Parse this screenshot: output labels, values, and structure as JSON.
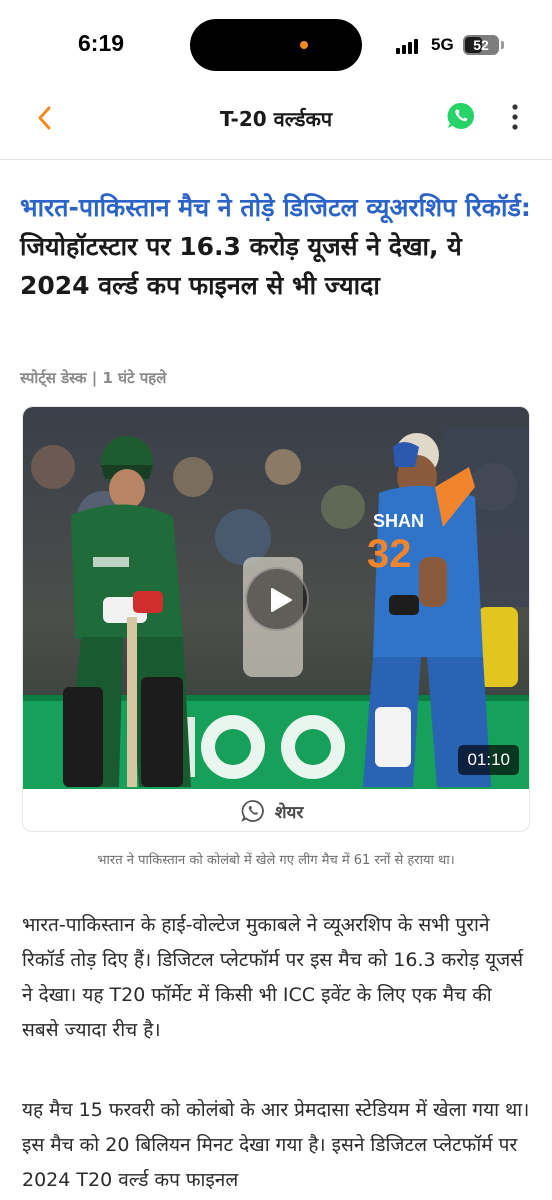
{
  "status_bar": {
    "time": "6:19",
    "network": "5G",
    "battery": "52",
    "battery_level": 0.52
  },
  "header": {
    "title": "T-20 वर्ल्डकप",
    "back_icon": "chevron-left-icon",
    "share_icon": "whatsapp-icon",
    "menu_icon": "more-vertical-icon",
    "accent_color": "#f28a1f",
    "whatsapp_color": "#25d366"
  },
  "article": {
    "headline_highlight": "भारत-पाकिस्तान मैच ने तोड़े डिजिटल व्यूअरशिप रिकॉर्ड:",
    "headline_rest": " जियोहॉटस्टार पर 16.3 करोड़ यूजर्स ने देखा, ये 2024 वर्ल्ड कप फाइनल से भी ज्यादा",
    "highlight_color": "#2b63c6",
    "byline": "स्पोर्ट्स डेस्क | 1 घंटे पहले",
    "video": {
      "duration": "01:10",
      "play_icon": "play-icon",
      "share_label": "शेयर",
      "share_icon": "whatsapp-icon"
    },
    "caption": "भारत ने पाकिस्तान को कोलंबो में खेले गए लीग मैच में 61 रनों से हराया था।",
    "paragraphs": [
      "भारत-पाकिस्तान के हाई-वोल्टेज मुकाबले ने व्यूअरशिप के सभी पुराने रिकॉर्ड तोड़ दिए हैं। डिजिटल प्लेटफॉर्म पर इस मैच को 16.3 करोड़ यूजर्स ने देखा। यह T20 फॉर्मेट में किसी भी ICC इवेंट के लिए एक मैच की सबसे ज्यादा रीच है।",
      "यह मैच 15 फरवरी को कोलंबो के आर प्रेमदासा स्टेडियम में खेला गया था। इस मैच को 20 बिलियन मिनट देखा गया है। इसने डिजिटल प्लेटफॉर्म पर 2024 T20 वर्ल्ड कप फाइनल"
    ]
  }
}
